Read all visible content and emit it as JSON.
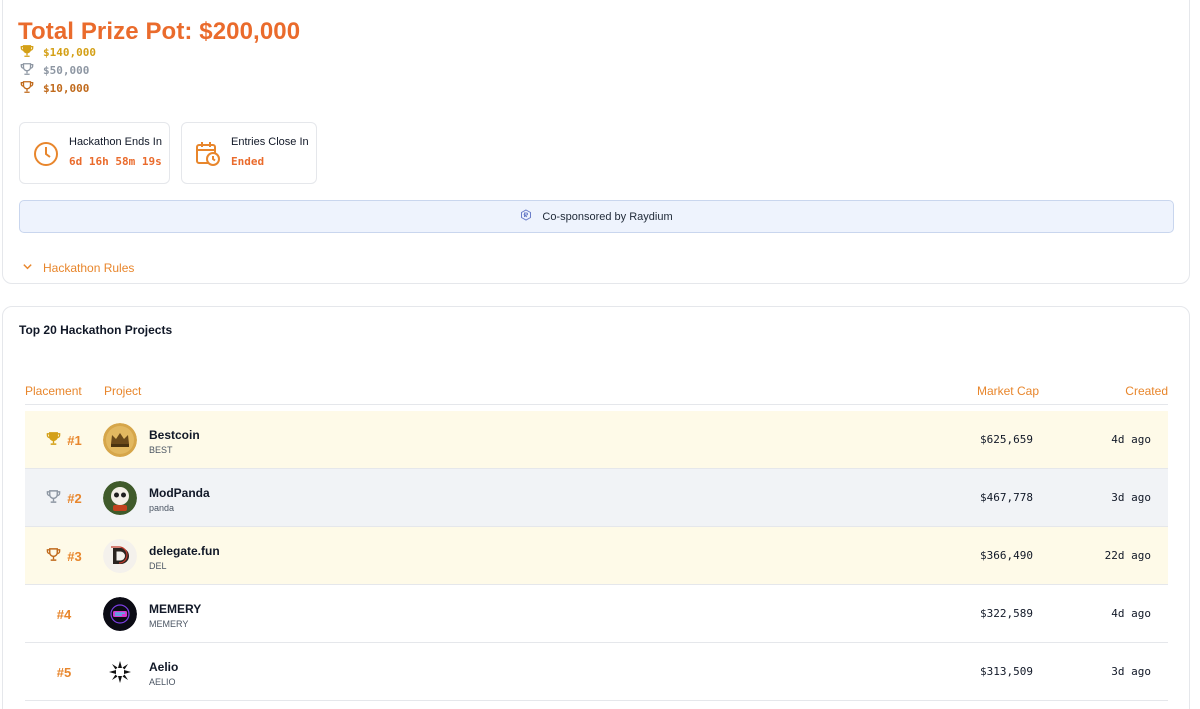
{
  "prize": {
    "title": "Total Prize Pot: $200,000",
    "tiers": [
      {
        "amount": "$140,000",
        "color": "#d4a017",
        "icon": "trophy-gold-icon"
      },
      {
        "amount": "$50,000",
        "color": "#8e97a3",
        "icon": "trophy-silver-icon"
      },
      {
        "amount": "$10,000",
        "color": "#c06a1c",
        "icon": "trophy-bronze-icon"
      }
    ]
  },
  "timers": {
    "hackathon": {
      "label": "Hackathon Ends In",
      "value": "6d 16h 58m 19s",
      "icon": "clock-icon"
    },
    "entries": {
      "label": "Entries Close In",
      "value": "Ended",
      "icon": "calendar-clock-icon"
    }
  },
  "sponsor": {
    "text": "Co-sponsored by Raydium",
    "icon": "raydium-logo-icon"
  },
  "rules": {
    "label": "Hackathon Rules",
    "icon": "chevron-down-icon"
  },
  "leaderboard": {
    "title": "Top 20 Hackathon Projects",
    "columns": {
      "placement": "Placement",
      "project": "Project",
      "market_cap": "Market Cap",
      "created": "Created"
    },
    "rows": [
      {
        "place": "#1",
        "name": "Bestcoin",
        "symbol": "BEST",
        "market_cap": "$625,659",
        "created": "4d ago",
        "trophy": "gold",
        "highlight": "#fefae8"
      },
      {
        "place": "#2",
        "name": "ModPanda",
        "symbol": "panda",
        "market_cap": "$467,778",
        "created": "3d ago",
        "trophy": "silver",
        "highlight": "#f1f3f6"
      },
      {
        "place": "#3",
        "name": "delegate.fun",
        "symbol": "DEL",
        "market_cap": "$366,490",
        "created": "22d ago",
        "trophy": "bronze",
        "highlight": "#fefae8"
      },
      {
        "place": "#4",
        "name": "MEMERY",
        "symbol": "MEMERY",
        "market_cap": "$322,589",
        "created": "4d ago",
        "trophy": "",
        "highlight": "#ffffff"
      },
      {
        "place": "#5",
        "name": "Aelio",
        "symbol": "AELIO",
        "market_cap": "$313,509",
        "created": "3d ago",
        "trophy": "",
        "highlight": "#ffffff"
      }
    ]
  },
  "colors": {
    "accent": "#ea6b2c",
    "accent_light": "#e8862c",
    "gold": "#d4a017",
    "silver": "#8e97a3",
    "bronze": "#c06a1c"
  }
}
